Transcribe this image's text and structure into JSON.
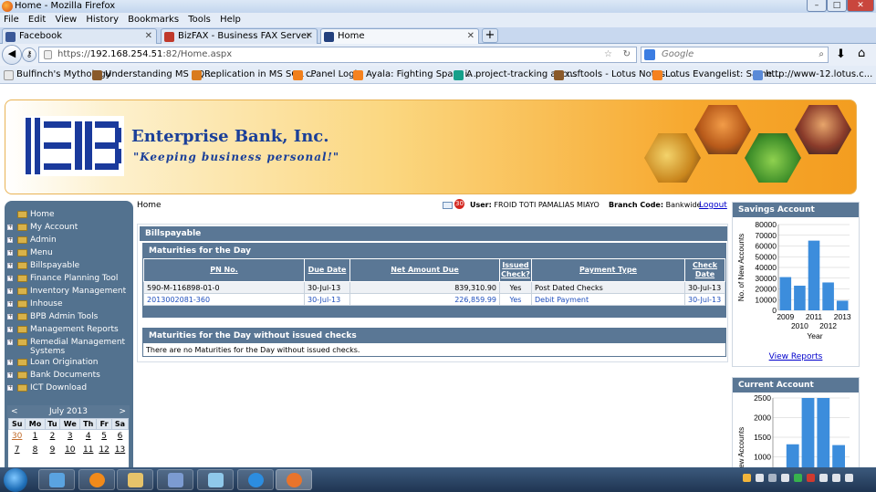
{
  "window": {
    "title": "Home - Mozilla Firefox",
    "controls": [
      "–",
      "□",
      "✕"
    ]
  },
  "menu": [
    "File",
    "Edit",
    "View",
    "History",
    "Bookmarks",
    "Tools",
    "Help"
  ],
  "tabs": [
    {
      "label": "Facebook",
      "icon": "facebook-icon",
      "color": "#3b5998"
    },
    {
      "label": "BizFAX - Business FAX Server",
      "icon": "bizfax-icon",
      "color": "#c0392b"
    },
    {
      "label": "Home",
      "icon": "home-tab-icon",
      "color": "#23407d"
    }
  ],
  "url": {
    "prefix": "https://",
    "host": "192.168.254.51",
    "path": ":82/Home.aspx"
  },
  "search": {
    "placeholder": "Google"
  },
  "bookmarks": [
    {
      "label": "Bulfinch's Mythology",
      "color": "#e8e8e8"
    },
    {
      "label": "Understanding MS SQ...",
      "color": "#8a5a2a"
    },
    {
      "label": "Replication in MS SQL ...",
      "color": "#d97b1e"
    },
    {
      "label": "cPanel Login",
      "color": "#f07f1b"
    },
    {
      "label": "Ayala: Fighting Spam i...",
      "color": "#f5821f"
    },
    {
      "label": "A project-tracking app...",
      "color": "#15a08a"
    },
    {
      "label": "nsftools - Lotus Notes ...",
      "color": "#8a5a2a"
    },
    {
      "label": "Lotus Evangelist: Same...",
      "color": "#f5821f"
    },
    {
      "label": "http://www-12.lotus.c...",
      "color": "#5a8ad8"
    }
  ],
  "banner": {
    "name": "Enterprise Bank, Inc.",
    "slogan": "\"Keeping business personal!\""
  },
  "sidebar": {
    "items": [
      {
        "label": "Home"
      },
      {
        "label": "My Account"
      },
      {
        "label": "Admin"
      },
      {
        "label": "Menu"
      },
      {
        "label": "Billspayable"
      },
      {
        "label": "Finance Planning Tool"
      },
      {
        "label": "Inventory Management"
      },
      {
        "label": "Inhouse"
      },
      {
        "label": "BPB Admin Tools"
      },
      {
        "label": "Management Reports"
      },
      {
        "label": "Remedial Management Systems"
      },
      {
        "label": "Loan Origination"
      },
      {
        "label": "Bank Documents"
      },
      {
        "label": "ICT Download"
      }
    ]
  },
  "calendar": {
    "title": "July 2013",
    "prev": "<",
    "next": ">",
    "days": [
      "Su",
      "Mo",
      "Tu",
      "We",
      "Th",
      "Fr",
      "Sa"
    ],
    "weeks": [
      [
        "30",
        "1",
        "2",
        "3",
        "4",
        "5",
        "6"
      ],
      [
        "7",
        "8",
        "9",
        "10",
        "11",
        "12",
        "13"
      ]
    ]
  },
  "header": {
    "breadcrumb": "Home",
    "notification_count": "30",
    "user_label": "User:",
    "user_name": "FROID TOTI PAMALIAS MIAYO",
    "branch_label": "Branch Code:",
    "branch_value": "Bankwide",
    "logout": "Logout"
  },
  "billspayable": {
    "title": "Billspayable",
    "maturities_title": "Maturities for the Day",
    "columns": [
      "PN No.",
      "Due Date",
      "Net Amount Due",
      "Issued Check?",
      "Payment Type",
      "Check Date"
    ],
    "rows": [
      {
        "pn": "590-M-116898-01-0",
        "due": "30-Jul-13",
        "amount": "839,310.90",
        "issued": "Yes",
        "type": "Post Dated Checks",
        "check_date": "30-Jul-13"
      },
      {
        "pn": "2013002081-360",
        "due": "30-Jul-13",
        "amount": "226,859.99",
        "issued": "Yes",
        "type": "Debit Payment",
        "check_date": "30-Jul-13"
      }
    ],
    "no_check_title": "Maturities for the Day without issued checks",
    "no_check_message": "There are no Maturities for the Day without issued checks."
  },
  "savings": {
    "title": "Savings Account",
    "view_reports": "View Reports"
  },
  "current": {
    "title": "Current Account"
  },
  "chart_data": [
    {
      "type": "bar",
      "title": "",
      "ylabel": "No. of New Accounts",
      "xlabel": "Year",
      "ylim": [
        0,
        80000
      ],
      "yticks": [
        0,
        10000,
        20000,
        30000,
        40000,
        50000,
        60000,
        70000,
        80000
      ],
      "categories": [
        "2009",
        "2010",
        "2011",
        "2012",
        "2013"
      ],
      "values": [
        31000,
        23000,
        65000,
        26000,
        9000
      ],
      "color": "#3c8ddc",
      "grid": true
    },
    {
      "type": "bar",
      "title": "",
      "ylabel": "No. of New Accounts",
      "ylim": [
        0,
        2500
      ],
      "yticks": [
        1000,
        1500,
        2000,
        2500
      ],
      "values": [
        1320,
        2500,
        2500,
        1300
      ],
      "color": "#3c8ddc",
      "grid": true
    }
  ]
}
